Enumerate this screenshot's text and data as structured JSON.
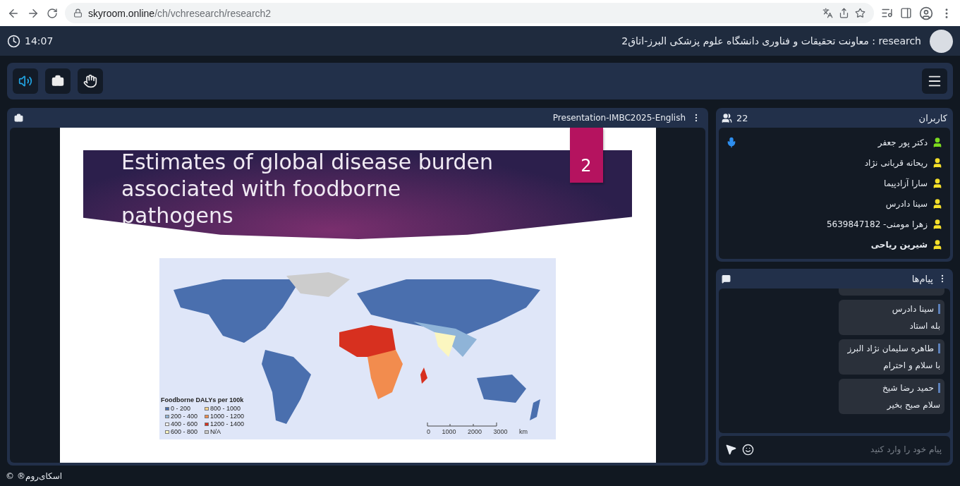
{
  "browser": {
    "url_host": "skyroom.online",
    "url_path": "/ch/vchresearch/research2"
  },
  "header": {
    "clock": "14:07",
    "room_title": "research : معاونت تحقیقات و فناوری دانشگاه علوم پزشکی البرز-اتاق2"
  },
  "toolbar": {
    "buttons": [
      {
        "kind": "speaker",
        "on": true
      },
      {
        "kind": "folder",
        "on": false
      },
      {
        "kind": "hand",
        "on": false
      }
    ]
  },
  "presentation": {
    "title": "Presentation-IMBC2025-English",
    "slide": {
      "title": "Estimates of global disease burden associated with foodborne pathogens",
      "number": "2",
      "map": {
        "legend_title": "Foodborne DALYs per 100k",
        "legend_left": [
          {
            "label": "0 - 200",
            "color": "#4a6fae"
          },
          {
            "label": "200 - 400",
            "color": "#8fb4d8"
          },
          {
            "label": "400 - 600",
            "color": "#f4f4f4"
          },
          {
            "label": "600 - 800",
            "color": "#fbf6c0"
          }
        ],
        "legend_right": [
          {
            "label": "800 - 1000",
            "color": "#f9d38c"
          },
          {
            "label": "1000 - 1200",
            "color": "#f28c4e"
          },
          {
            "label": "1200 - 1400",
            "color": "#d7301f"
          },
          {
            "label": "N/A",
            "color": "#cccccc"
          }
        ],
        "scale_label": "0 1000 2000 3000 km"
      }
    }
  },
  "users": {
    "title": "کاربران",
    "count": "22",
    "items": [
      {
        "name": "دکتر پور جعفر",
        "color": "#7ddc1f",
        "mic": true,
        "self": false
      },
      {
        "name": "ریحانه قربانی نژاد",
        "color": "#f5e02a",
        "mic": false,
        "self": false
      },
      {
        "name": "سارا آزادپیما",
        "color": "#f5e02a",
        "mic": false,
        "self": false
      },
      {
        "name": "سینا دادرس",
        "color": "#f5e02a",
        "mic": false,
        "self": false
      },
      {
        "name": "زهرا مومنی- 5639847182",
        "color": "#f5e02a",
        "mic": false,
        "self": false
      },
      {
        "name": "شیرین ریاحی",
        "color": "#f5e02a",
        "mic": false,
        "self": true
      }
    ]
  },
  "messages": {
    "title": "پیام‌ها",
    "items": [
      {
        "sender": "سینا دادرس",
        "text": "بله استاد"
      },
      {
        "sender": "طاهره سلیمان نژاد البرز",
        "text": "با سلام و احترام"
      },
      {
        "sender": "حمید رضا شیخ",
        "text": "سلام صبح بخیر"
      }
    ],
    "input": {
      "placeholder": "پیام خود را وارد کنید"
    }
  },
  "footer": {
    "symbol": "©",
    "brand": "اسکای‌روم®"
  }
}
